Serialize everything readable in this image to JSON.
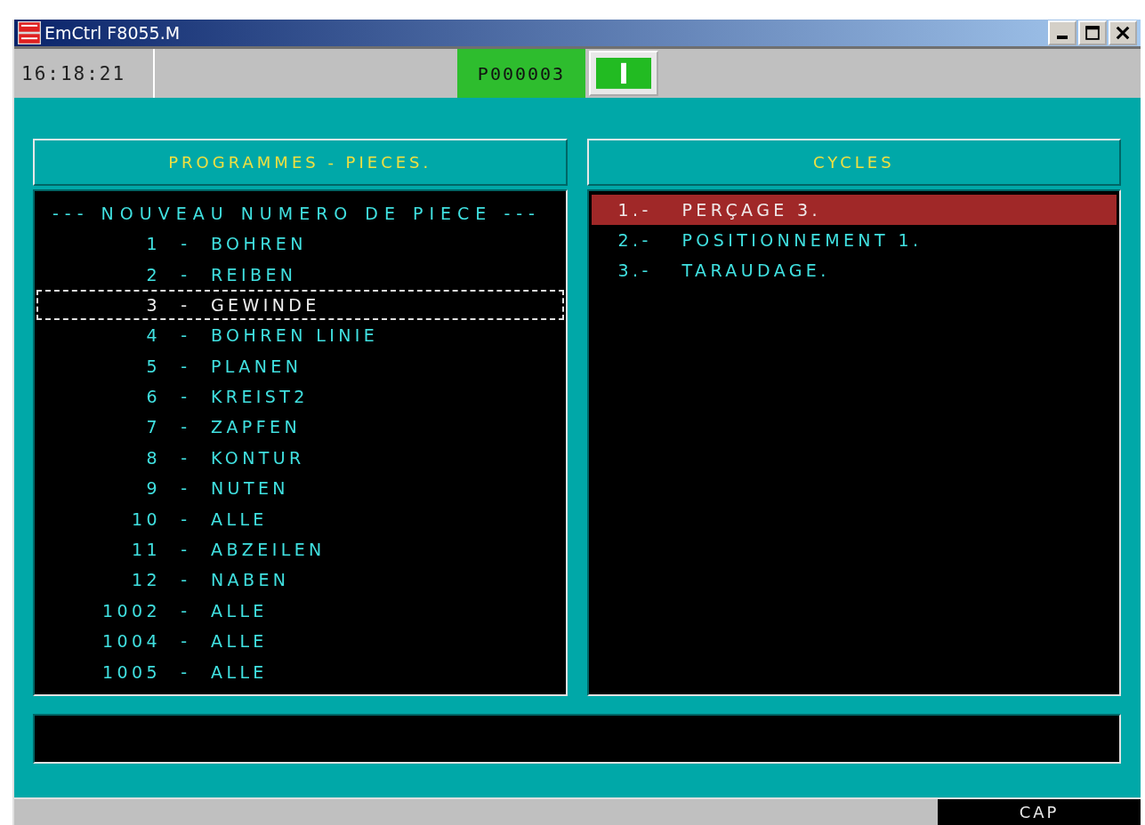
{
  "window": {
    "title": "EmCtrl F8055.M"
  },
  "toolbar": {
    "clock": "16:18:21",
    "program": "P000003"
  },
  "programs": {
    "title": "PROGRAMMES - PIECES.",
    "heading": "--- NOUVEAU NUMERO DE PIECE ---",
    "items": [
      {
        "number": "1",
        "separator": "-",
        "name": "BOHREN",
        "selected": false
      },
      {
        "number": "2",
        "separator": "-",
        "name": "REIBEN",
        "selected": false
      },
      {
        "number": "3",
        "separator": "-",
        "name": "GEWINDE",
        "selected": true
      },
      {
        "number": "4",
        "separator": "-",
        "name": "BOHREN LINIE",
        "selected": false
      },
      {
        "number": "5",
        "separator": "-",
        "name": "PLANEN",
        "selected": false
      },
      {
        "number": "6",
        "separator": "-",
        "name": "KREIST2",
        "selected": false
      },
      {
        "number": "7",
        "separator": "-",
        "name": "ZAPFEN",
        "selected": false
      },
      {
        "number": "8",
        "separator": "-",
        "name": "KONTUR",
        "selected": false
      },
      {
        "number": "9",
        "separator": "-",
        "name": "NUTEN",
        "selected": false
      },
      {
        "number": "10",
        "separator": "-",
        "name": "ALLE",
        "selected": false
      },
      {
        "number": "11",
        "separator": "-",
        "name": "ABZEILEN",
        "selected": false
      },
      {
        "number": "12",
        "separator": "-",
        "name": "NABEN",
        "selected": false
      },
      {
        "number": "1002",
        "separator": "-",
        "name": "ALLE",
        "selected": false
      },
      {
        "number": "1004",
        "separator": "-",
        "name": "ALLE",
        "selected": false
      },
      {
        "number": "1005",
        "separator": "-",
        "name": "ALLE",
        "selected": false
      }
    ]
  },
  "cycles": {
    "title": "CYCLES",
    "items": [
      {
        "number": "1.-",
        "name": "PERÇAGE 3.",
        "selected": true
      },
      {
        "number": "2.-",
        "name": "POSITIONNEMENT 1.",
        "selected": false
      },
      {
        "number": "3.-",
        "name": "TARAUDAGE.",
        "selected": false
      }
    ]
  },
  "status_bar": {
    "mode": "CAP"
  }
}
